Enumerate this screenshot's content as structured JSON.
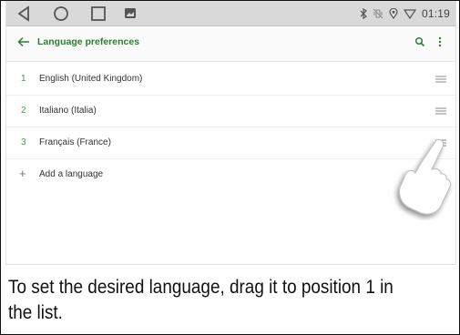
{
  "status_bar": {
    "time": "01:19",
    "nav_icons": [
      "back-triangle-icon",
      "home-circle-icon",
      "recents-square-icon",
      "gallery-icon"
    ],
    "status_icons": [
      "bluetooth-icon",
      "vibrate-icon",
      "location-icon",
      "wifi-icon"
    ]
  },
  "app_bar": {
    "title": "Language preferences",
    "accent_color": "#2e7d32"
  },
  "languages": [
    {
      "num": "1",
      "label": "English (United Kingdom)"
    },
    {
      "num": "2",
      "label": "Italiano (Italia)"
    },
    {
      "num": "3",
      "label": "Français (France)"
    }
  ],
  "add_language": {
    "label": "Add a language"
  },
  "caption": "To set the desired language, drag it to position 1 in the list."
}
